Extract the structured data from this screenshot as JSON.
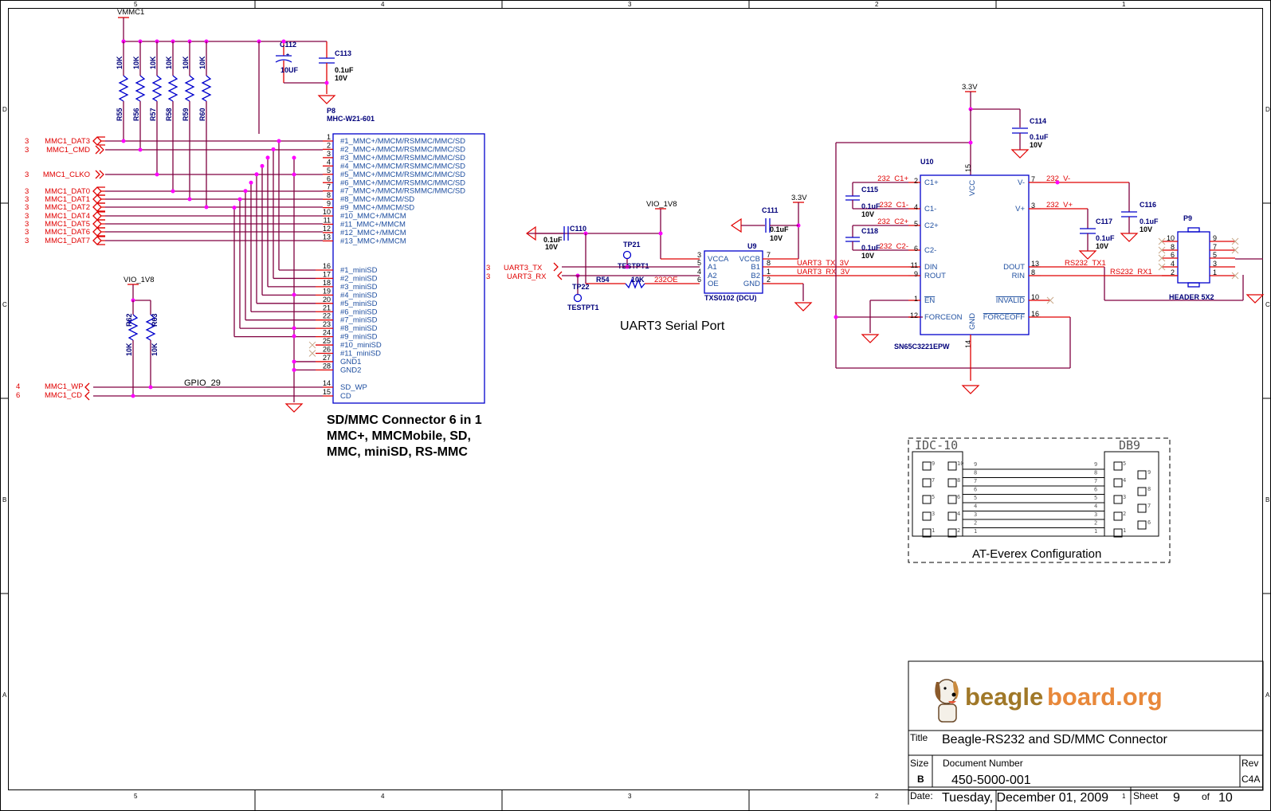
{
  "frame": {
    "top_columns": [
      "5",
      "4",
      "3",
      "2",
      "1"
    ],
    "bottom_columns": [
      "5",
      "4",
      "3",
      "2",
      "1"
    ],
    "rows": [
      "D",
      "C",
      "B",
      "A"
    ]
  },
  "sdmmc": {
    "power_label": "VMMC1",
    "pullups": [
      {
        "ref": "R55",
        "value": "10K"
      },
      {
        "ref": "R56",
        "value": "10K"
      },
      {
        "ref": "R57",
        "value": "10K"
      },
      {
        "ref": "R58",
        "value": "10K"
      },
      {
        "ref": "R59",
        "value": "10K"
      },
      {
        "ref": "R60",
        "value": "10K"
      }
    ],
    "c112": {
      "ref": "C112",
      "value": "10UF",
      "polarity": "+"
    },
    "c113": {
      "ref": "C113",
      "value": "0.1uF",
      "voltage": "10V"
    },
    "connector": {
      "ref": "P8",
      "part": "MHC-W21-601"
    },
    "signals": [
      {
        "sheet": "3",
        "name": "MMC1_DAT3"
      },
      {
        "sheet": "3",
        "name": "MMC1_CMD"
      },
      {
        "sheet": "3",
        "name": "MMC1_CLKO"
      },
      {
        "sheet": "3",
        "name": "MMC1_DAT0"
      },
      {
        "sheet": "3",
        "name": "MMC1_DAT1"
      },
      {
        "sheet": "3",
        "name": "MMC1_DAT2"
      },
      {
        "sheet": "3",
        "name": "MMC1_DAT4"
      },
      {
        "sheet": "3",
        "name": "MMC1_DAT5"
      },
      {
        "sheet": "3",
        "name": "MMC1_DAT6"
      },
      {
        "sheet": "3",
        "name": "MMC1_DAT7"
      }
    ],
    "pins_top": [
      {
        "num": "1",
        "name": "#1_MMC+/MMCM/RSMMC/MMC/SD"
      },
      {
        "num": "2",
        "name": "#2_MMC+/MMCM/RSMMC/MMC/SD"
      },
      {
        "num": "3",
        "name": "#3_MMC+/MMCM/RSMMC/MMC/SD"
      },
      {
        "num": "4",
        "name": "#4_MMC+/MMCM/RSMMC/MMC/SD"
      },
      {
        "num": "5",
        "name": "#5_MMC+/MMCM/RSMMC/MMC/SD"
      },
      {
        "num": "6",
        "name": "#6_MMC+/MMCM/RSMMC/MMC/SD"
      },
      {
        "num": "7",
        "name": "#7_MMC+/MMCM/RSMMC/MMC/SD"
      },
      {
        "num": "8",
        "name": "#8_MMC+/MMCM/SD"
      },
      {
        "num": "9",
        "name": "#9_MMC+/MMCM/SD"
      },
      {
        "num": "10",
        "name": "#10_MMC+/MMCM"
      },
      {
        "num": "11",
        "name": "#11_MMC+/MMCM"
      },
      {
        "num": "12",
        "name": "#12_MMC+/MMCM"
      },
      {
        "num": "13",
        "name": "#13_MMC+/MMCM"
      }
    ],
    "pins_mini": [
      {
        "num": "16",
        "name": "#1_miniSD"
      },
      {
        "num": "17",
        "name": "#2_miniSD"
      },
      {
        "num": "18",
        "name": "#3_miniSD"
      },
      {
        "num": "19",
        "name": "#4_miniSD"
      },
      {
        "num": "20",
        "name": "#5_miniSD"
      },
      {
        "num": "21",
        "name": "#6_miniSD"
      },
      {
        "num": "22",
        "name": "#7_miniSD"
      },
      {
        "num": "23",
        "name": "#8_miniSD"
      },
      {
        "num": "24",
        "name": "#9_miniSD"
      },
      {
        "num": "25",
        "name": "#10_miniSD"
      },
      {
        "num": "26",
        "name": "#11_miniSD"
      },
      {
        "num": "27",
        "name": "GND1"
      },
      {
        "num": "28",
        "name": "GND2"
      }
    ],
    "pins_bottom": [
      {
        "num": "14",
        "name": "SD_WP"
      },
      {
        "num": "15",
        "name": "CD"
      }
    ],
    "wp_cd_power": "VIO_1V8",
    "r62": {
      "ref": "R62",
      "value": "10K"
    },
    "r63": {
      "ref": "R63",
      "value": "10K"
    },
    "wp_signals": [
      {
        "sheet": "4",
        "name": "MMC1_WP"
      },
      {
        "sheet": "6",
        "name": "MMC1_CD"
      }
    ],
    "gpio_label": "GPIO_29",
    "caption_lines": [
      "SD/MMC Connector 6 in 1",
      "MMC+, MMCMobile, SD,",
      "MMC, miniSD, RS-MMC"
    ]
  },
  "uart": {
    "power_label": "VIO_1V8",
    "power_33": "3.3V",
    "c110": {
      "ref": "C110",
      "value": "0.1uF",
      "voltage": "10V"
    },
    "c111": {
      "ref": "C111",
      "value": "0.1uF",
      "voltage": "10V"
    },
    "tp21": {
      "ref": "TP21",
      "part": "TESTPT1"
    },
    "tp22": {
      "ref": "TP22",
      "part": "TESTPT1"
    },
    "r54": {
      "ref": "R54",
      "value": "10K",
      "net": "232OE"
    },
    "signals": [
      {
        "sheet": "3",
        "name": "UART3_TX"
      },
      {
        "sheet": "3",
        "name": "UART3_RX"
      }
    ],
    "u9": {
      "ref": "U9",
      "part": "TXS0102 (DCU)",
      "left_pins": [
        {
          "num": "3",
          "name": "VCCA"
        },
        {
          "num": "5",
          "name": "A1"
        },
        {
          "num": "4",
          "name": "A2"
        },
        {
          "num": "6",
          "name": "OE"
        }
      ],
      "right_pins": [
        {
          "num": "7",
          "name": "VCCB"
        },
        {
          "num": "8",
          "name": "B1"
        },
        {
          "num": "1",
          "name": "B2"
        },
        {
          "num": "2",
          "name": "GND"
        }
      ]
    },
    "nets_3v": [
      "UART3_TX_3V",
      "UART3_RX_3V"
    ],
    "caption": "UART3 Serial Port"
  },
  "rs232": {
    "power_label": "3.3V",
    "c114": {
      "ref": "C114",
      "value": "0.1uF",
      "voltage": "10V"
    },
    "c115": {
      "ref": "C115",
      "value": "0.1uF",
      "voltage": "10V"
    },
    "c118": {
      "ref": "C118",
      "value": "0.1uF",
      "voltage": "10V"
    },
    "c116": {
      "ref": "C116",
      "value": "0.1uF",
      "voltage": "10V"
    },
    "c117": {
      "ref": "C117",
      "value": "0.1uF",
      "voltage": "10V"
    },
    "u10": {
      "ref": "U10",
      "part": "SN65C3221EPW",
      "vcc": {
        "num": "15",
        "name": "VCC"
      },
      "gnd": {
        "num": "14",
        "name": "GND"
      },
      "left_pins": [
        {
          "num": "2",
          "name": "C1+",
          "net": "232_C1+"
        },
        {
          "num": "4",
          "name": "C1-",
          "net": "232_C1-"
        },
        {
          "num": "5",
          "name": "C2+",
          "net": "232_C2+"
        },
        {
          "num": "6",
          "name": "C2-",
          "net": "232_C2-"
        },
        {
          "num": "11",
          "name": "DIN",
          "net": ""
        },
        {
          "num": "9",
          "name": "ROUT",
          "net": ""
        },
        {
          "num": "1",
          "name": "EN",
          "net": ""
        },
        {
          "num": "12",
          "name": "FORCEON",
          "net": ""
        }
      ],
      "right_pins": [
        {
          "num": "7",
          "name": "V-",
          "net": "232_V-"
        },
        {
          "num": "3",
          "name": "V+",
          "net": "232_V+"
        },
        {
          "num": "13",
          "name": "DOUT",
          "net": "RS232_TX1"
        },
        {
          "num": "8",
          "name": "RIN",
          "net": "RS232_RX1"
        },
        {
          "num": "10",
          "name": "INVALID",
          "net": ""
        },
        {
          "num": "16",
          "name": "FORCEOFF",
          "net": ""
        }
      ]
    },
    "p9": {
      "ref": "P9",
      "part": "HEADER 5X2",
      "left_pins": [
        "10",
        "8",
        "6",
        "4",
        "2"
      ],
      "right_pins": [
        "9",
        "7",
        "5",
        "3",
        "1"
      ]
    }
  },
  "cable": {
    "left_title": "IDC-10",
    "right_title": "DB9",
    "idc_left": [
      "9",
      "7",
      "5",
      "3",
      "1"
    ],
    "idc_right": [
      "10",
      "8",
      "6",
      "4",
      "2"
    ],
    "wires": [
      "9",
      "8",
      "7",
      "6",
      "5",
      "4",
      "3",
      "2",
      "1"
    ],
    "db9_left": [
      "5",
      "4",
      "3",
      "2",
      "1"
    ],
    "db9_right": [
      "9",
      "8",
      "7",
      "6"
    ],
    "caption": "AT-Everex Configuration"
  },
  "titleblock": {
    "logo_text_a": "beagle",
    "logo_text_b": "board.org",
    "title_label": "Title",
    "title": "Beagle-RS232 and SD/MMC Connector",
    "size_label": "Size",
    "size": "B",
    "docnum_label": "Document Number",
    "docnum": "450-5000-001",
    "rev_label": "Rev",
    "rev": "C4A",
    "date_label": "Date:",
    "date": "Tuesday, December 01, 2009",
    "sheet_label": "Sheet",
    "sheet": "9",
    "of_label": "of",
    "total": "10"
  },
  "colors": {
    "wire": "#800040",
    "pin": "#e00000",
    "part": "#0000cc",
    "junction": "#ff00ff",
    "logo_brown": "#a07828",
    "logo_orange": "#e8883a"
  }
}
